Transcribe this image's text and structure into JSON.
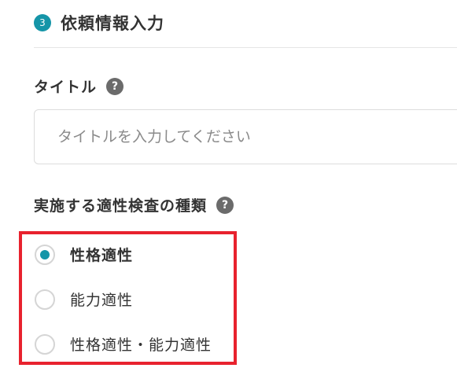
{
  "section": {
    "step_number": "3",
    "title": "依頼情報入力"
  },
  "title_field": {
    "label": "タイトル",
    "help_icon": "?",
    "placeholder": "タイトルを入力してください",
    "value": ""
  },
  "test_type_field": {
    "label": "実施する適性検査の種類",
    "help_icon": "?",
    "options": [
      {
        "label": "性格適性",
        "selected": true
      },
      {
        "label": "能力適性",
        "selected": false
      },
      {
        "label": "性格適性・能力適性",
        "selected": false
      }
    ]
  },
  "colors": {
    "accent": "#1595a8",
    "highlight": "#e8222e",
    "help_icon_bg": "#6b6b6b",
    "text": "#333333"
  },
  "icons": {
    "step_badge": "numbered-circle-icon",
    "help": "question-circle-icon",
    "radio_selected": "radio-checked-icon",
    "radio_unselected": "radio-unchecked-icon"
  }
}
